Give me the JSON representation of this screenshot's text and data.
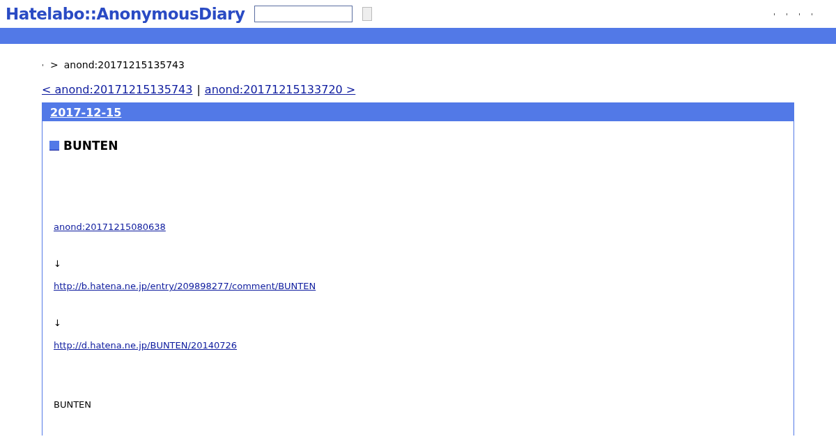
{
  "header": {
    "logo": "Hatelabo::AnonymousDiary"
  },
  "breadcrumb": {
    "separator": ">",
    "current": "anond:20171215135743"
  },
  "pager": {
    "prev": "< anond:20171215135743",
    "separator": "|",
    "next": "anond:20171215133720 >"
  },
  "day": {
    "date": "2017-12-15",
    "title": "BUNTEN",
    "body": [
      {
        "kind": "link",
        "text": "anond:20171215080638"
      },
      {
        "kind": "text",
        "text": "↓"
      },
      {
        "kind": "link",
        "text": "http://b.hatena.ne.jp/entry/209898277/comment/BUNTEN"
      },
      {
        "kind": "text",
        "text": "↓"
      },
      {
        "kind": "link",
        "text": "http://d.hatena.ne.jp/BUNTEN/20140726"
      },
      {
        "kind": "text",
        "text": "BUNTEN"
      }
    ]
  }
}
